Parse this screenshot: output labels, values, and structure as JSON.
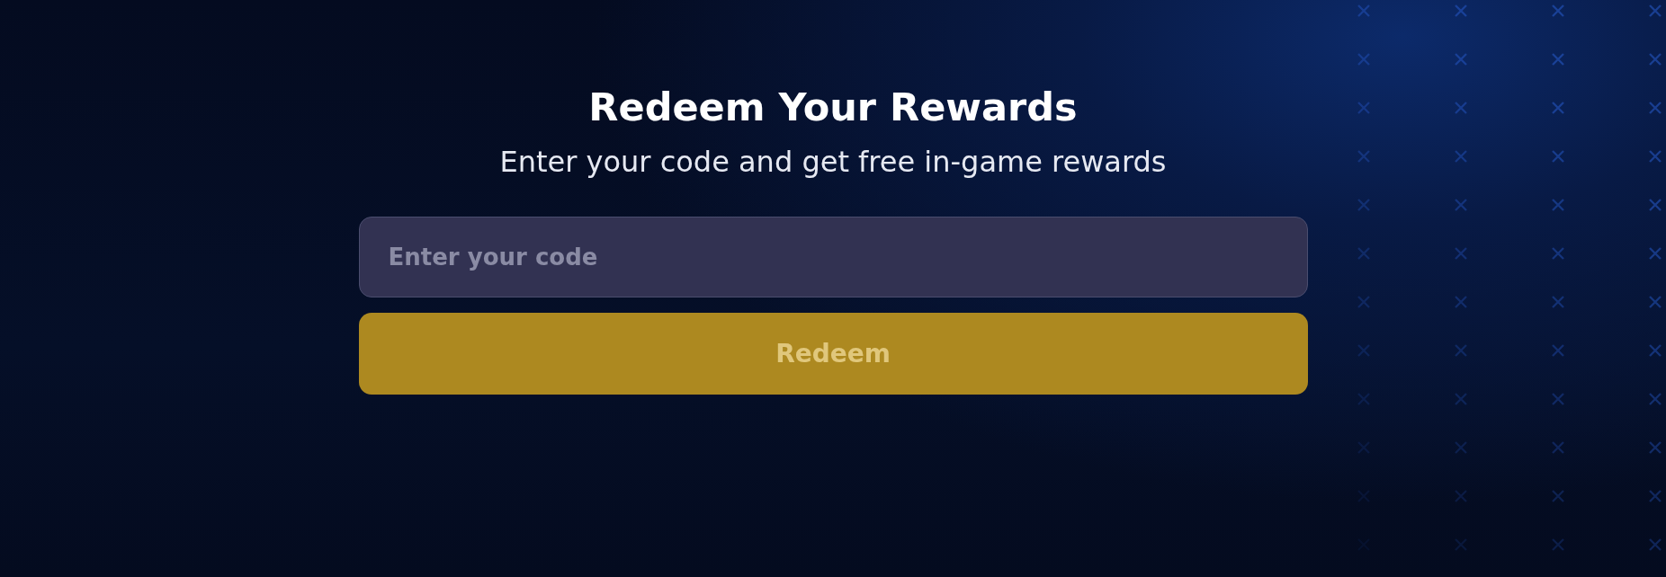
{
  "title": "Redeem Your Rewards",
  "subtitle": "Enter your code and get free in-game rewards",
  "code_field": {
    "placeholder": "Enter your code"
  },
  "redeem_button": {
    "label": "Redeem",
    "disabled": true
  }
}
